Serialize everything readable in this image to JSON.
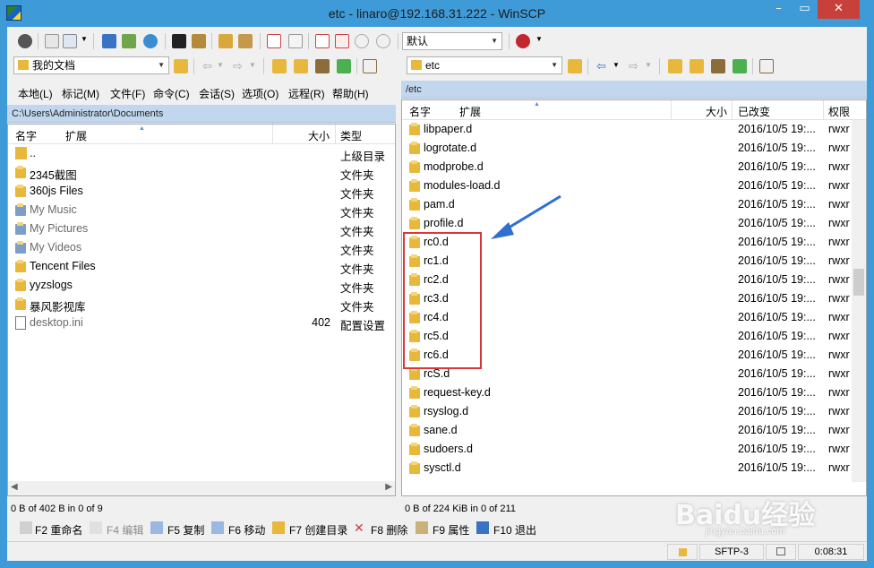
{
  "window": {
    "title": "etc - linaro@192.168.31.222 - WinSCP",
    "min": "–",
    "max": "▭",
    "close": "✕"
  },
  "toolbar": {
    "session_preset": "默认"
  },
  "left": {
    "location": "我的文档",
    "path": "C:\\Users\\Administrator\\Documents",
    "menu": [
      "本地(L)",
      "标记(M)",
      "文件(F)",
      "命令(C)",
      "会话(S)",
      "选项(O)",
      "远程(R)",
      "帮助(H)"
    ],
    "columns": {
      "name": "名字",
      "ext": "扩展",
      "size": "大小",
      "type": "类型"
    },
    "rows": [
      {
        "name": "..",
        "size": "",
        "type": "上级目录",
        "icon": "parent-dir-icon",
        "dim": false
      },
      {
        "name": "2345截图",
        "size": "",
        "type": "文件夹",
        "icon": "folder-icon",
        "dim": false
      },
      {
        "name": "360js Files",
        "size": "",
        "type": "文件夹",
        "icon": "folder-icon",
        "dim": false
      },
      {
        "name": "My Music",
        "size": "",
        "type": "文件夹",
        "icon": "music-folder-icon",
        "dim": true
      },
      {
        "name": "My Pictures",
        "size": "",
        "type": "文件夹",
        "icon": "pictures-folder-icon",
        "dim": true
      },
      {
        "name": "My Videos",
        "size": "",
        "type": "文件夹",
        "icon": "videos-folder-icon",
        "dim": true
      },
      {
        "name": "Tencent Files",
        "size": "",
        "type": "文件夹",
        "icon": "folder-icon",
        "dim": false
      },
      {
        "name": "yyzslogs",
        "size": "",
        "type": "文件夹",
        "icon": "folder-icon",
        "dim": false
      },
      {
        "name": "暴风影视库",
        "size": "",
        "type": "文件夹",
        "icon": "folder-icon",
        "dim": false
      },
      {
        "name": "desktop.ini",
        "size": "402",
        "type": "配置设置",
        "icon": "ini-file-icon",
        "dim": true
      }
    ],
    "status": "0 B of 402 B in 0 of 9"
  },
  "right": {
    "location": "etc",
    "path": "/etc",
    "columns": {
      "name": "名字",
      "ext": "扩展",
      "size": "大小",
      "modified": "已改变",
      "perms": "权限"
    },
    "rows": [
      {
        "name": "libpaper.d",
        "modified": "2016/10/5 19:...",
        "perms": "rwxr"
      },
      {
        "name": "logrotate.d",
        "modified": "2016/10/5 19:...",
        "perms": "rwxr"
      },
      {
        "name": "modprobe.d",
        "modified": "2016/10/5 19:...",
        "perms": "rwxr"
      },
      {
        "name": "modules-load.d",
        "modified": "2016/10/5 19:...",
        "perms": "rwxr"
      },
      {
        "name": "pam.d",
        "modified": "2016/10/5 19:...",
        "perms": "rwxr"
      },
      {
        "name": "profile.d",
        "modified": "2016/10/5 19:...",
        "perms": "rwxr"
      },
      {
        "name": "rc0.d",
        "modified": "2016/10/5 19:...",
        "perms": "rwxr"
      },
      {
        "name": "rc1.d",
        "modified": "2016/10/5 19:...",
        "perms": "rwxr"
      },
      {
        "name": "rc2.d",
        "modified": "2016/10/5 19:...",
        "perms": "rwxr"
      },
      {
        "name": "rc3.d",
        "modified": "2016/10/5 19:...",
        "perms": "rwxr"
      },
      {
        "name": "rc4.d",
        "modified": "2016/10/5 19:...",
        "perms": "rwxr"
      },
      {
        "name": "rc5.d",
        "modified": "2016/10/5 19:...",
        "perms": "rwxr"
      },
      {
        "name": "rc6.d",
        "modified": "2016/10/5 19:...",
        "perms": "rwxr"
      },
      {
        "name": "rcS.d",
        "modified": "2016/10/5 19:...",
        "perms": "rwxr"
      },
      {
        "name": "request-key.d",
        "modified": "2016/10/5 19:...",
        "perms": "rwxr"
      },
      {
        "name": "rsyslog.d",
        "modified": "2016/10/5 19:...",
        "perms": "rwxr"
      },
      {
        "name": "sane.d",
        "modified": "2016/10/5 19:...",
        "perms": "rwxr"
      },
      {
        "name": "sudoers.d",
        "modified": "2016/10/5 19:...",
        "perms": "rwxr"
      },
      {
        "name": "sysctl.d",
        "modified": "2016/10/5 19:...",
        "perms": "rwxr"
      }
    ],
    "status": "0 B of 224 KiB in 0 of 211"
  },
  "fkeys": [
    {
      "label": "F2 重命名",
      "icon": "rename-icon",
      "enabled": true
    },
    {
      "label": "F4 编辑",
      "icon": "edit-icon",
      "enabled": false
    },
    {
      "label": "F5 复制",
      "icon": "copy-icon",
      "enabled": true
    },
    {
      "label": "F6 移动",
      "icon": "move-icon",
      "enabled": true
    },
    {
      "label": "F7 创建目录",
      "icon": "new-folder-icon",
      "enabled": true
    },
    {
      "label": "F8 删除",
      "icon": "delete-icon",
      "enabled": true
    },
    {
      "label": "F9 属性",
      "icon": "properties-icon",
      "enabled": true
    },
    {
      "label": "F10 退出",
      "icon": "exit-icon",
      "enabled": true
    }
  ],
  "statusbar": {
    "protocol": "SFTP-3",
    "elapsed": "0:08:31"
  },
  "watermark": {
    "logo": "Baidu经验",
    "url": "jingyan.baidu.com"
  },
  "colors": {
    "titlebar": "#3f9bd8",
    "path_bar": "#c2d7ee",
    "highlight_box": "#d9383a",
    "annotation_arrow": "#2f6fd1",
    "folder": "#e8b83c"
  }
}
